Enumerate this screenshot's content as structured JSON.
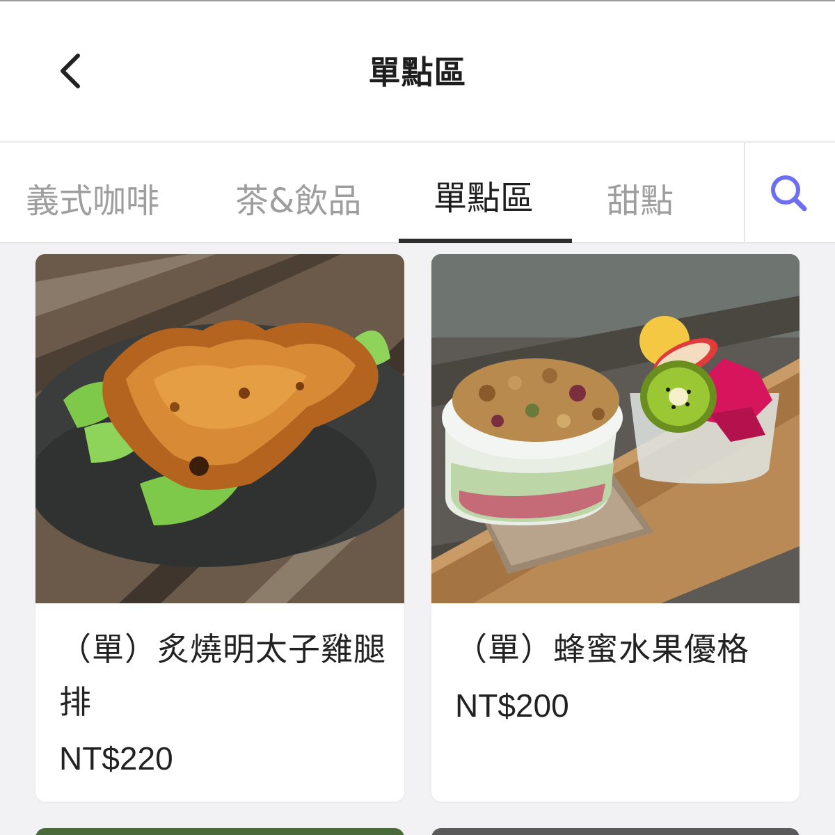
{
  "header": {
    "title": "單點區",
    "back_icon": "chevron-left-icon"
  },
  "tabs": [
    {
      "label": "義式咖啡",
      "active": false
    },
    {
      "label": "茶&飲品",
      "active": false
    },
    {
      "label": "單點區",
      "active": true
    },
    {
      "label": "甜點",
      "active": false
    }
  ],
  "search": {
    "icon": "search-icon",
    "color": "#6b6ff0"
  },
  "products": [
    {
      "name": "（單）炙燒明太子雞腿排",
      "price": "NT$220",
      "photo": "grilled-chicken-thigh-photo"
    },
    {
      "name": "（單）蜂蜜水果優格",
      "price": "NT$200",
      "photo": "honey-fruit-yogurt-photo"
    }
  ],
  "colors": {
    "background": "#f2f2f4",
    "active_tab": "#1e1e1e",
    "inactive_tab": "#9e9e9e",
    "accent": "#6b6ff0"
  }
}
